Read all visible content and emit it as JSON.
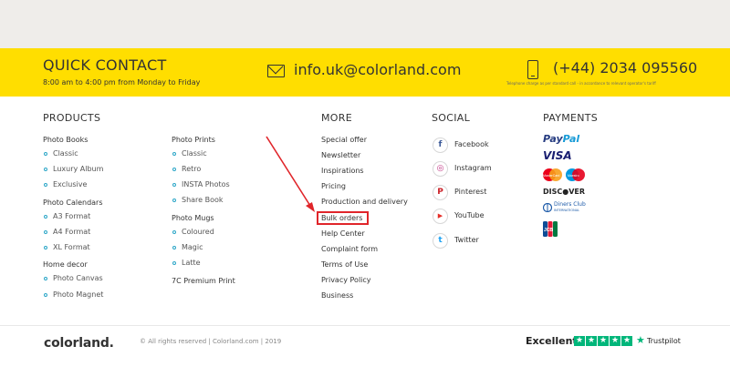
{
  "contact": {
    "title": "QUICK CONTACT",
    "hours": "8:00 am to 4:00 pm from Monday to Friday",
    "email": "info.uk@colorland.com",
    "phone": "(+44) 2034 095560",
    "phone_note": "Telephone charge as per standard call - in accordance to relevant operator's tariff"
  },
  "products": {
    "title": "PRODUCTS",
    "groups": [
      {
        "name": "Photo Books",
        "items": [
          "Classic",
          "Luxury Album",
          "Exclusive"
        ]
      },
      {
        "name": "Photo Calendars",
        "items": [
          "A3 Format",
          "A4 Format",
          "XL Format"
        ]
      },
      {
        "name": "Home decor",
        "items": [
          "Photo Canvas",
          "Photo Magnet"
        ]
      },
      {
        "name": "Photo Prints",
        "items": [
          "Classic",
          "Retro",
          "INSTA Photos",
          "Share Book"
        ]
      },
      {
        "name": "Photo Mugs",
        "items": [
          "Coloured",
          "Magic",
          "Latte"
        ]
      },
      {
        "name": "7C Premium Print",
        "items": []
      }
    ]
  },
  "more": {
    "title": "MORE",
    "links": [
      "Special offer",
      "Newsletter",
      "Inspirations",
      "Pricing",
      "Production and delivery",
      "Bulk orders",
      "Help Center",
      "Complaint form",
      "Terms of Use",
      "Privacy Policy",
      "Business"
    ]
  },
  "social": {
    "title": "SOCIAL",
    "items": [
      {
        "label": "Facebook",
        "icon": "facebook-icon",
        "color": "#3b5998",
        "glyph": "f"
      },
      {
        "label": "Instagram",
        "icon": "instagram-icon",
        "color": "#c13584",
        "glyph": "◎"
      },
      {
        "label": "Pinterest",
        "icon": "pinterest-icon",
        "color": "#cb2027",
        "glyph": "P"
      },
      {
        "label": "YouTube",
        "icon": "youtube-icon",
        "color": "#e52d27",
        "glyph": "▶"
      },
      {
        "label": "Twitter",
        "icon": "twitter-icon",
        "color": "#1da1f2",
        "glyph": "t"
      }
    ]
  },
  "payments": {
    "title": "PAYMENTS",
    "paypal_a": "Pay",
    "paypal_b": "Pal",
    "visa": "VISA",
    "mastercard": "MasterCard",
    "maestro": "Maestro",
    "discover_a": "DISC",
    "discover_b": "VER",
    "diners_a": "Diners Club",
    "diners_b": "INTERNATIONAL",
    "jcb": "JCB"
  },
  "footer": {
    "logo": "colorland.",
    "copyright": "© All rights reserved | Colorland.com | 2019",
    "rating_label": "Excellent",
    "trustpilot": "Trustpilot"
  },
  "colors": {
    "yellow": "#ffde00",
    "accent_blue": "#2aa6c7",
    "highlight_red": "#e0252a",
    "trustpilot_green": "#00b67a"
  }
}
